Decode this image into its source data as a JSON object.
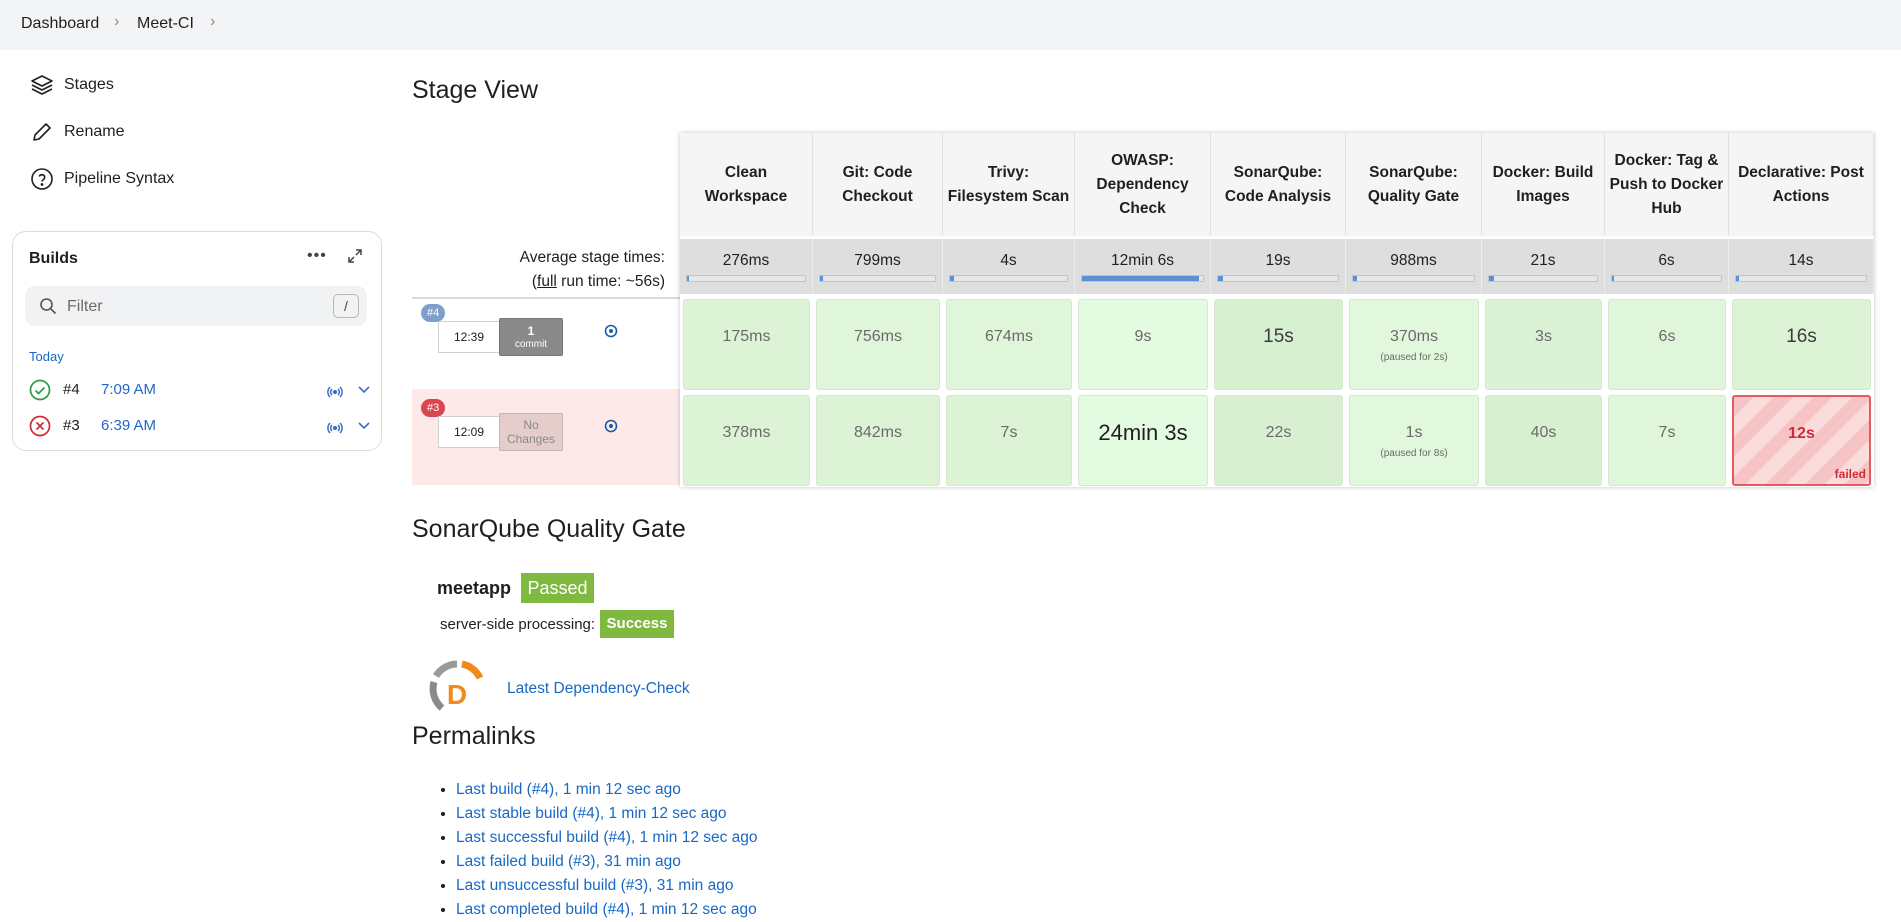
{
  "breadcrumb": {
    "items": [
      "Dashboard",
      "Meet-CI"
    ]
  },
  "sidebar": {
    "items": [
      {
        "label": "Stages",
        "icon": "layers-icon"
      },
      {
        "label": "Rename",
        "icon": "pencil-icon"
      },
      {
        "label": "Pipeline Syntax",
        "icon": "help-circle-icon"
      }
    ]
  },
  "builds": {
    "title": "Builds",
    "filter_placeholder": "Filter",
    "filter_shortcut": "/",
    "group": "Today",
    "items": [
      {
        "number": "#4",
        "time": "7:09 AM",
        "status": "success"
      },
      {
        "number": "#3",
        "time": "6:39 AM",
        "status": "failed"
      }
    ]
  },
  "stage_view": {
    "title": "Stage View",
    "average_label": "Average stage times:",
    "full_run_prefix": "(",
    "full_run_link": "full",
    "full_run_suffix": " run time: ~56s)",
    "stages": [
      {
        "name": "Clean Workspace",
        "avg": "276ms",
        "avg_fraction": 0.02
      },
      {
        "name": "Git: Code Checkout",
        "avg": "799ms",
        "avg_fraction": 0.03
      },
      {
        "name": "Trivy: Filesystem Scan",
        "avg": "4s",
        "avg_fraction": 0.03
      },
      {
        "name": "OWASP: Dependency Check",
        "avg": "12min 6s",
        "avg_fraction": 0.97
      },
      {
        "name": "SonarQube: Code Analysis",
        "avg": "19s",
        "avg_fraction": 0.04
      },
      {
        "name": "SonarQube: Quality Gate",
        "avg": "988ms",
        "avg_fraction": 0.03
      },
      {
        "name": "Docker: Build Images",
        "avg": "21s",
        "avg_fraction": 0.05
      },
      {
        "name": "Docker: Tag & Push to Docker Hub",
        "avg": "6s",
        "avg_fraction": 0.02
      },
      {
        "name": "Declarative: Post Actions",
        "avg": "14s",
        "avg_fraction": 0.02
      }
    ],
    "runs": [
      {
        "badge": "#4",
        "time": "12:39",
        "changes_line1": "1",
        "changes_line2": "commit",
        "status": "success",
        "cells": [
          "175ms",
          "756ms",
          "674ms",
          "9s",
          "15s",
          "370ms",
          "3s",
          "6s",
          "16s"
        ],
        "paused": {
          "5": "(paused for 2s)"
        }
      },
      {
        "badge": "#3",
        "time": "12:09",
        "changes_line1": "No",
        "changes_line2": "Changes",
        "status": "failed",
        "cells": [
          "378ms",
          "842ms",
          "7s",
          "24min 3s",
          "22s",
          "1s",
          "40s",
          "7s",
          "12s"
        ],
        "paused": {
          "5": "(paused for 8s)"
        },
        "failed_label": "failed"
      }
    ]
  },
  "quality_gate": {
    "title": "SonarQube Quality Gate",
    "project": "meetapp",
    "status": "Passed",
    "processing_label": "server-side processing:",
    "processing_status": "Success"
  },
  "dependency_check": {
    "link": "Latest Dependency-Check",
    "logo_letter": "D"
  },
  "permalinks": {
    "title": "Permalinks",
    "items": [
      "Last build (#4), 1 min 12 sec ago",
      "Last stable build (#4), 1 min 12 sec ago",
      "Last successful build (#4), 1 min 12 sec ago",
      "Last failed build (#3), 31 min ago",
      "Last unsuccessful build (#3), 31 min ago",
      "Last completed build (#4), 1 min 12 sec ago"
    ]
  },
  "colors": {
    "success": "#80b940",
    "failed": "#e35a62",
    "link": "#1769c4",
    "cell_green": "#dff5d8",
    "row_failed": "#fde9e7"
  }
}
